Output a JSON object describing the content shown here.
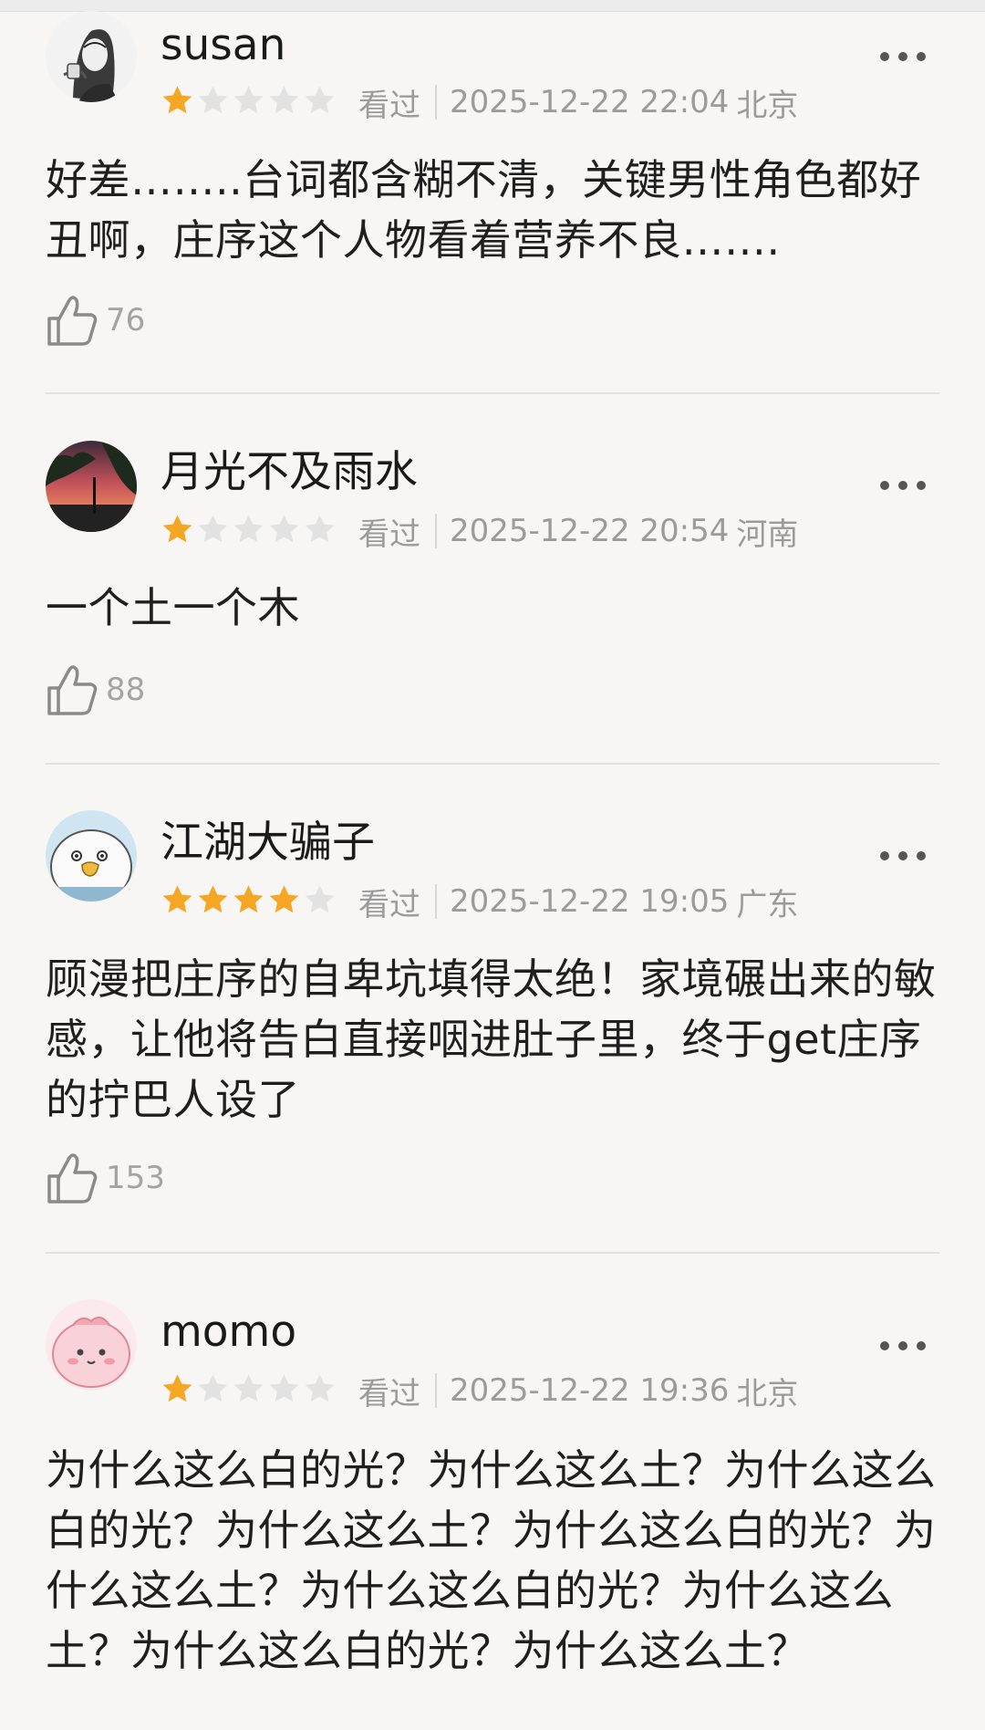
{
  "reviews": [
    {
      "username": "susan",
      "rating": 1,
      "status": "看过",
      "datetime": "2025-12-22 22:04",
      "location": "北京",
      "text": "好差……..台词都含糊不清，关键男性角色都好丑啊，庄序这个人物看着营养不良…….",
      "likes": "76"
    },
    {
      "username": "月光不及雨水",
      "rating": 1,
      "status": "看过",
      "datetime": "2025-12-22 20:54",
      "location": "河南",
      "text": "一个土一个木",
      "likes": "88"
    },
    {
      "username": "江湖大骗子",
      "rating": 4,
      "status": "看过",
      "datetime": "2025-12-22 19:05",
      "location": "广东",
      "text": "顾漫把庄序的自卑坑填得太绝！家境碾出来的敏感，让他将告白直接咽进肚子里，终于get庄序的拧巴人设了",
      "likes": "153"
    },
    {
      "username": "momo",
      "rating": 1,
      "status": "看过",
      "datetime": "2025-12-22 19:36",
      "location": "北京",
      "text": "为什么这么白的光？为什么这么土？为什么这么白的光？为什么这么土？为什么这么白的光？为什么这么土？为什么这么白的光？为什么这么土？为什么这么白的光？为什么这么土？",
      "likes": ""
    }
  ],
  "colors": {
    "star_on": "#f5a623",
    "star_off": "#e2e2e2",
    "meta": "#9b9b9b",
    "background": "#f7f6f5"
  },
  "icons": {
    "more": "more-dots-icon",
    "like": "thumbs-up-icon",
    "star": "star-icon"
  }
}
